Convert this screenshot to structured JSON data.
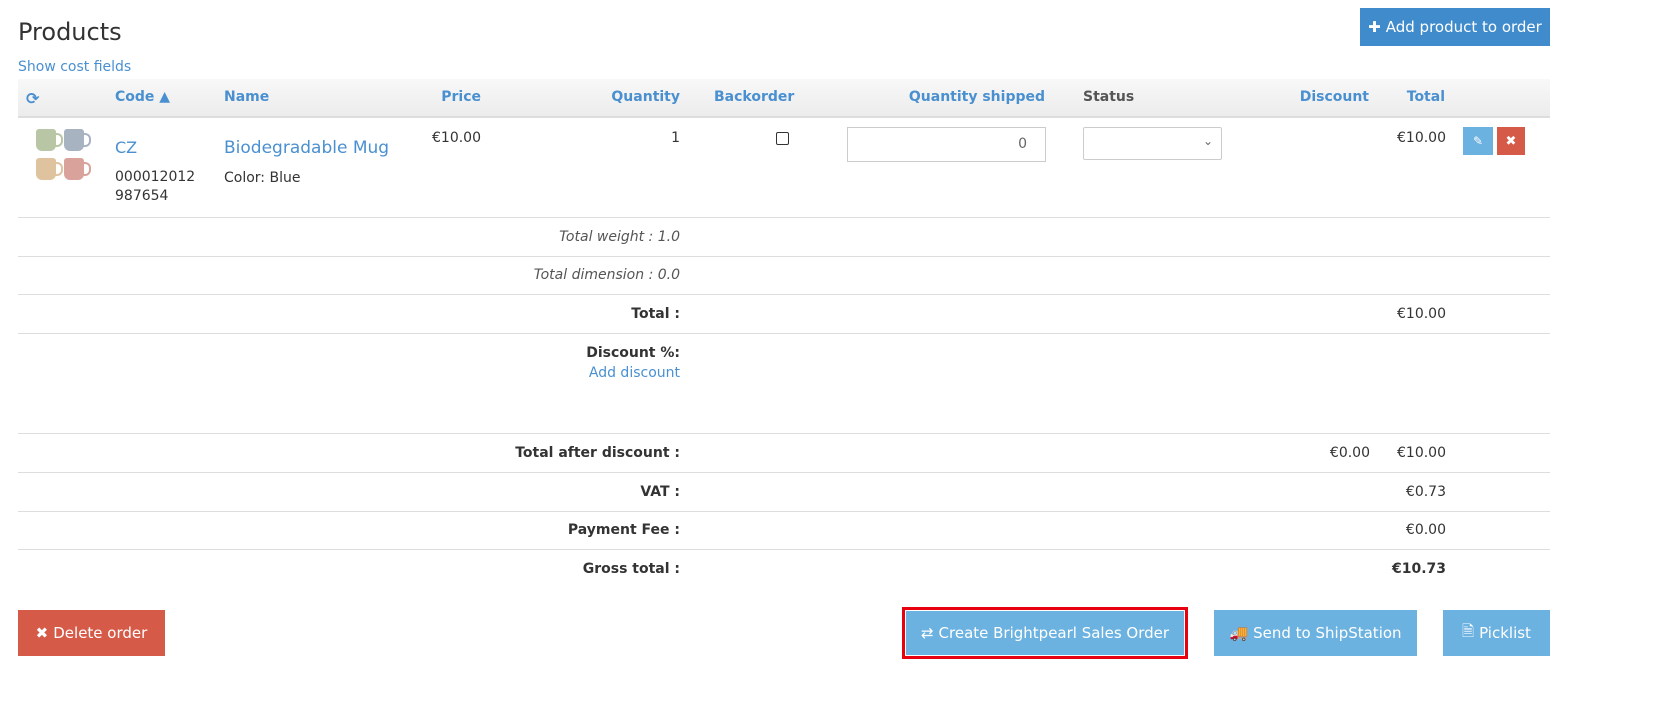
{
  "title": "Products",
  "show_cost_fields": "Show cost fields",
  "add_product": "Add product to order",
  "columns": {
    "code": "Code ▲",
    "name": "Name",
    "price": "Price",
    "quantity": "Quantity",
    "backorder": "Backorder",
    "quantity_shipped": "Quantity shipped",
    "status": "Status",
    "discount": "Discount",
    "total": "Total"
  },
  "product": {
    "code": "CZ",
    "barcode_1": "000012012",
    "barcode_2": "987654",
    "name": "Biodegradable Mug",
    "variant": "Color: Blue",
    "price": "€10.00",
    "quantity": "1",
    "backorder": false,
    "quantity_shipped": "0",
    "status": "",
    "total": "€10.00"
  },
  "summary": {
    "total_weight": "Total weight : 1.0",
    "total_dimension": "Total dimension : 0.0",
    "total_label": "Total :",
    "total_value": "€10.00",
    "discount_label": "Discount %:",
    "add_discount": "Add discount",
    "after_discount_label": "Total after discount :",
    "after_discount_discount": "€0.00",
    "after_discount_value": "€10.00",
    "vat_label": "VAT :",
    "vat_value": "€0.73",
    "payment_fee_label": "Payment Fee :",
    "payment_fee_value": "€0.00",
    "gross_label": "Gross total :",
    "gross_value": "€10.73"
  },
  "actions": {
    "delete": "Delete order",
    "brightpearl": "Create Brightpearl Sales Order",
    "shipstation": "Send to ShipStation",
    "picklist": "Picklist"
  },
  "colors": {
    "primary": "#3f8bcb",
    "info": "#6cb2e0",
    "danger": "#d65a48",
    "highlight": "#e8000f"
  }
}
